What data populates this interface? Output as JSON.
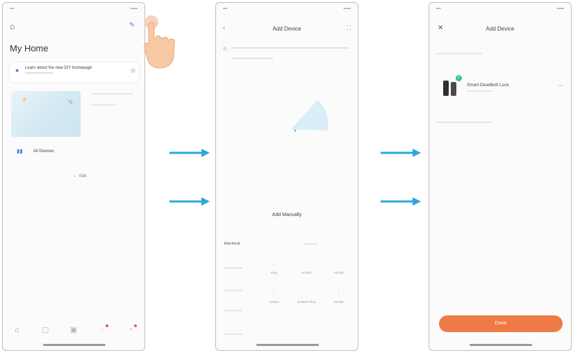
{
  "colors": {
    "arrow": "#29a8dc",
    "accent": "#ee7b45",
    "check": "#39c48a",
    "home_tab": "#f07a3e"
  },
  "phone1": {
    "title": "My Home",
    "banner_text": "Learn about the new DIY homepage",
    "temp_unit": "°C",
    "all_devices": "All Devices",
    "edit": "Edit",
    "icons": [
      "home-icon",
      "paint-icon",
      "plus-icon",
      "minus-icon",
      "location-pin-icon",
      "sun-icon",
      "devices-icon"
    ],
    "tabs": [
      "home-tab-icon",
      "scene-tab-icon",
      "smart-tab-icon",
      "mall-tab-icon",
      "me-tab-icon"
    ]
  },
  "phone2": {
    "title": "Add Device",
    "add_manually": "Add Manually",
    "category": "Electrical",
    "devices": [
      {
        "name": "Plug"
      },
      {
        "name": "Socket"
      },
      {
        "name": "Socket"
      },
      {
        "name": "Socket"
      },
      {
        "name": "Outdoor Plug"
      },
      {
        "name": "Socket"
      }
    ]
  },
  "phone3": {
    "title": "Add Device",
    "device_name": "Smart Deadbolt Lock",
    "button_label": "Done"
  }
}
